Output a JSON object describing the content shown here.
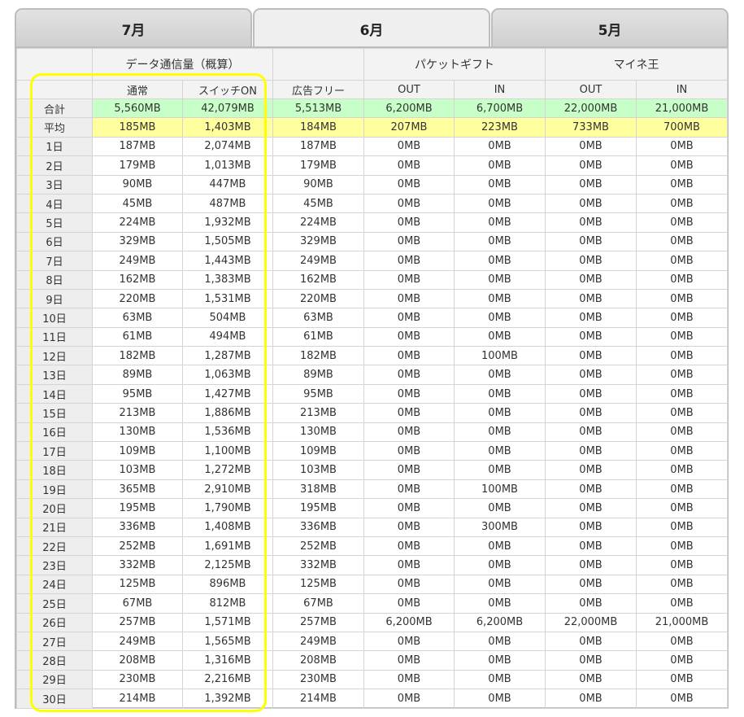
{
  "tabs": [
    {
      "label": "7月",
      "active": false
    },
    {
      "label": "6月",
      "active": true
    },
    {
      "label": "5月",
      "active": false
    }
  ],
  "table": {
    "groups": {
      "data": "データ通信量（概算）",
      "gift": "パケットギフト",
      "maine": "マイネ王"
    },
    "columns": [
      "通常",
      "スイッチON",
      "広告フリー",
      "OUT",
      "IN",
      "OUT",
      "IN"
    ],
    "total": {
      "label": "合計",
      "values": [
        "5,560MB",
        "42,079MB",
        "5,513MB",
        "6,200MB",
        "6,700MB",
        "22,000MB",
        "21,000MB"
      ]
    },
    "average": {
      "label": "平均",
      "values": [
        "185MB",
        "1,403MB",
        "184MB",
        "207MB",
        "223MB",
        "733MB",
        "700MB"
      ]
    },
    "rows": [
      {
        "label": "1日",
        "values": [
          "187MB",
          "2,074MB",
          "187MB",
          "0MB",
          "0MB",
          "0MB",
          "0MB"
        ]
      },
      {
        "label": "2日",
        "values": [
          "179MB",
          "1,013MB",
          "179MB",
          "0MB",
          "0MB",
          "0MB",
          "0MB"
        ]
      },
      {
        "label": "3日",
        "values": [
          "90MB",
          "447MB",
          "90MB",
          "0MB",
          "0MB",
          "0MB",
          "0MB"
        ]
      },
      {
        "label": "4日",
        "values": [
          "45MB",
          "487MB",
          "45MB",
          "0MB",
          "0MB",
          "0MB",
          "0MB"
        ]
      },
      {
        "label": "5日",
        "values": [
          "224MB",
          "1,932MB",
          "224MB",
          "0MB",
          "0MB",
          "0MB",
          "0MB"
        ]
      },
      {
        "label": "6日",
        "values": [
          "329MB",
          "1,505MB",
          "329MB",
          "0MB",
          "0MB",
          "0MB",
          "0MB"
        ]
      },
      {
        "label": "7日",
        "values": [
          "249MB",
          "1,443MB",
          "249MB",
          "0MB",
          "0MB",
          "0MB",
          "0MB"
        ]
      },
      {
        "label": "8日",
        "values": [
          "162MB",
          "1,383MB",
          "162MB",
          "0MB",
          "0MB",
          "0MB",
          "0MB"
        ]
      },
      {
        "label": "9日",
        "values": [
          "220MB",
          "1,531MB",
          "220MB",
          "0MB",
          "0MB",
          "0MB",
          "0MB"
        ]
      },
      {
        "label": "10日",
        "values": [
          "63MB",
          "504MB",
          "63MB",
          "0MB",
          "0MB",
          "0MB",
          "0MB"
        ]
      },
      {
        "label": "11日",
        "values": [
          "61MB",
          "494MB",
          "61MB",
          "0MB",
          "0MB",
          "0MB",
          "0MB"
        ]
      },
      {
        "label": "12日",
        "values": [
          "182MB",
          "1,287MB",
          "182MB",
          "0MB",
          "100MB",
          "0MB",
          "0MB"
        ]
      },
      {
        "label": "13日",
        "values": [
          "89MB",
          "1,063MB",
          "89MB",
          "0MB",
          "0MB",
          "0MB",
          "0MB"
        ]
      },
      {
        "label": "14日",
        "values": [
          "95MB",
          "1,427MB",
          "95MB",
          "0MB",
          "0MB",
          "0MB",
          "0MB"
        ]
      },
      {
        "label": "15日",
        "values": [
          "213MB",
          "1,886MB",
          "213MB",
          "0MB",
          "0MB",
          "0MB",
          "0MB"
        ]
      },
      {
        "label": "16日",
        "values": [
          "130MB",
          "1,536MB",
          "130MB",
          "0MB",
          "0MB",
          "0MB",
          "0MB"
        ]
      },
      {
        "label": "17日",
        "values": [
          "109MB",
          "1,100MB",
          "109MB",
          "0MB",
          "0MB",
          "0MB",
          "0MB"
        ]
      },
      {
        "label": "18日",
        "values": [
          "103MB",
          "1,272MB",
          "103MB",
          "0MB",
          "0MB",
          "0MB",
          "0MB"
        ]
      },
      {
        "label": "19日",
        "values": [
          "365MB",
          "2,910MB",
          "318MB",
          "0MB",
          "100MB",
          "0MB",
          "0MB"
        ]
      },
      {
        "label": "20日",
        "values": [
          "195MB",
          "1,790MB",
          "195MB",
          "0MB",
          "0MB",
          "0MB",
          "0MB"
        ]
      },
      {
        "label": "21日",
        "values": [
          "336MB",
          "1,408MB",
          "336MB",
          "0MB",
          "300MB",
          "0MB",
          "0MB"
        ]
      },
      {
        "label": "22日",
        "values": [
          "252MB",
          "1,691MB",
          "252MB",
          "0MB",
          "0MB",
          "0MB",
          "0MB"
        ]
      },
      {
        "label": "23日",
        "values": [
          "332MB",
          "2,125MB",
          "332MB",
          "0MB",
          "0MB",
          "0MB",
          "0MB"
        ]
      },
      {
        "label": "24日",
        "values": [
          "125MB",
          "896MB",
          "125MB",
          "0MB",
          "0MB",
          "0MB",
          "0MB"
        ]
      },
      {
        "label": "25日",
        "values": [
          "67MB",
          "812MB",
          "67MB",
          "0MB",
          "0MB",
          "0MB",
          "0MB"
        ]
      },
      {
        "label": "26日",
        "values": [
          "257MB",
          "1,571MB",
          "257MB",
          "6,200MB",
          "6,200MB",
          "22,000MB",
          "21,000MB"
        ]
      },
      {
        "label": "27日",
        "values": [
          "249MB",
          "1,565MB",
          "249MB",
          "0MB",
          "0MB",
          "0MB",
          "0MB"
        ]
      },
      {
        "label": "28日",
        "values": [
          "208MB",
          "1,316MB",
          "208MB",
          "0MB",
          "0MB",
          "0MB",
          "0MB"
        ]
      },
      {
        "label": "29日",
        "values": [
          "230MB",
          "2,216MB",
          "230MB",
          "0MB",
          "0MB",
          "0MB",
          "0MB"
        ]
      },
      {
        "label": "30日",
        "values": [
          "214MB",
          "1,392MB",
          "214MB",
          "0MB",
          "0MB",
          "0MB",
          "0MB"
        ]
      }
    ]
  },
  "colors": {
    "total_row": "#c8ffc8",
    "average_row": "#ffff9e",
    "highlight_outline": "#ffff00",
    "header_bg": "#f3f3f3",
    "border": "#bdbdbd"
  }
}
